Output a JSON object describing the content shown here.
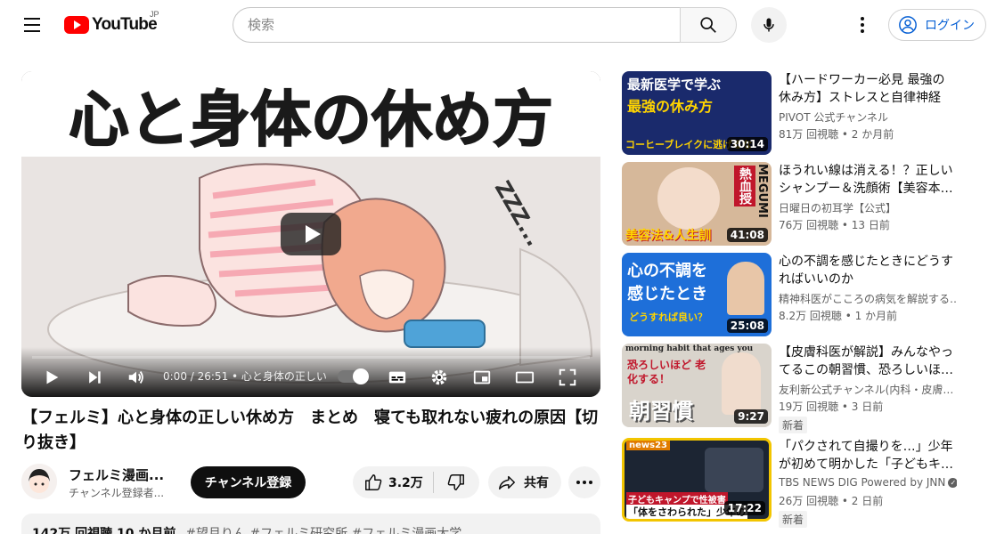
{
  "header": {
    "logo_text": "YouTube",
    "logo_region": "JP",
    "search_placeholder": "検索",
    "login_label": "ログイン"
  },
  "player": {
    "thumbnail_text": "心と身体の休め方",
    "sfx_text": "ZZZ...",
    "time_display": "0:00 / 26:51 • 心と身体の正しい",
    "progress": 0
  },
  "video": {
    "title": "【フェルミ】心と身体の正しい休め方　まとめ　寝ても取れない疲れの原因【切り抜き】",
    "channel_name": "フェルミ漫画...",
    "channel_subs": "チャンネル登録者...",
    "subscribe_label": "チャンネル登録",
    "like_count": "3.2万",
    "share_label": "共有",
    "description_views": "142万 回視聴  10 か月前",
    "description_tags": "#望月りん #フェルミ研究所 #フェルミ漫画大学"
  },
  "recommendations": [
    {
      "title": "【ハードワーカー必見 最強の休み方】ストレスと自律神経を…",
      "channel": "PIVOT 公式チャンネル",
      "meta": "81万 回視聴 • 2 か月前",
      "duration": "30:14",
      "thumb_line1": "最新医学で学ぶ",
      "thumb_line2": "最強の休み方",
      "thumb_line3": "コーヒーブレイクに逃げるな",
      "thumb_bg": "#1a2a6c",
      "verified": false,
      "badge": ""
    },
    {
      "title": "ほうれい線は消える！？正しいシャンプー＆洗顔術【美容本…",
      "channel": "日曜日の初耳学【公式】",
      "meta": "76万 回視聴 • 13 日前",
      "duration": "41:08",
      "thumb_line1": "熱血授",
      "thumb_line2": "美容法&人生訓",
      "thumb_line3": "MEGUMI",
      "thumb_bg": "#d6b89a",
      "verified": false,
      "badge": ""
    },
    {
      "title": "心の不調を感じたときにどうすればいいのか",
      "channel": "精神科医がこころの病気を解説する…",
      "meta": "8.2万 回視聴 • 1 か月前",
      "duration": "25:08",
      "thumb_line1": "心の不調を",
      "thumb_line2": "感じたとき",
      "thumb_line3": "どうすれば良い？",
      "thumb_bg": "#1e6fd9",
      "verified": false,
      "badge": ""
    },
    {
      "title": "【皮膚科医が解説】みんなやってるこの朝習慣、恐ろしいほ…",
      "channel": "友利新公式チャンネル(内科・皮膚…",
      "meta": "19万 回視聴 • 3 日前",
      "duration": "9:27",
      "thumb_line1": "morning habit that ages you",
      "thumb_line2": "恐ろしいほど 老化する！",
      "thumb_line3": "朝習慣",
      "thumb_bg": "#d9d4cc",
      "verified": false,
      "badge": "新着"
    },
    {
      "title": "「パクされて自撮りを…」少年が初めて明かした「子どもキ…",
      "channel": "TBS NEWS DIG Powered by JNN",
      "meta": "26万 回視聴 • 2 日前",
      "duration": "17:22",
      "thumb_line1": "news23",
      "thumb_line2": "子どもキャンプで性被害",
      "thumb_line3": "「体をさわられた」少年の",
      "thumb_bg": "#1c2533",
      "verified": true,
      "badge": "新着"
    }
  ]
}
